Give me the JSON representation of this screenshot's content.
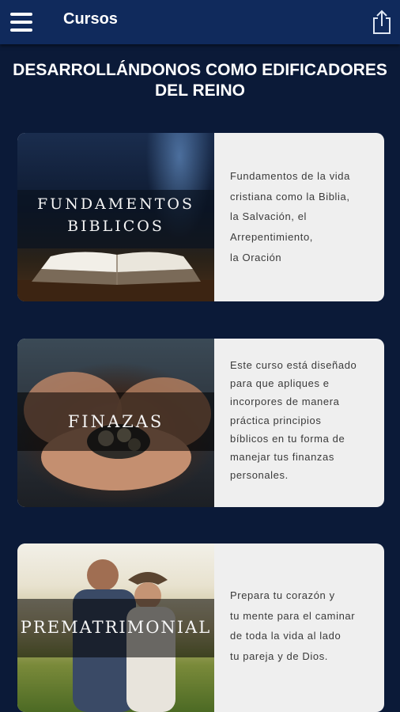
{
  "appbar": {
    "title": "Cursos"
  },
  "heading": {
    "line1": "DESARROLLÁNDONOS COMO EDIFICADORES",
    "line2": "DEL REINO"
  },
  "courses": [
    {
      "banner_lines": [
        "FUNDAMENTOS",
        "BIBLICOS"
      ],
      "description_lines": [
        "Fundamentos de la vida",
        "cristiana como la Biblia,",
        "la Salvación, el",
        "Arrepentimiento,",
        "la Oración"
      ]
    },
    {
      "banner_lines": [
        "FINAZAS"
      ],
      "description_lines": [
        "Este curso está diseñado",
        "para que apliques e",
        "incorpores de manera",
        "práctica principios",
        "bíblicos en tu forma de",
        "manejar tus finanzas",
        "personales."
      ]
    },
    {
      "banner_lines": [
        "PREMATRIMONIAL"
      ],
      "description_lines": [
        "Prepara tu corazón y",
        "tu mente para el caminar",
        "de toda la vida al lado",
        "tu pareja y de Dios."
      ]
    }
  ],
  "icons": {
    "menu": "hamburger-menu-icon",
    "share": "share-icon"
  },
  "colors": {
    "appbar": "#102a5c",
    "background": "#0b1a38",
    "card": "#efefef"
  }
}
